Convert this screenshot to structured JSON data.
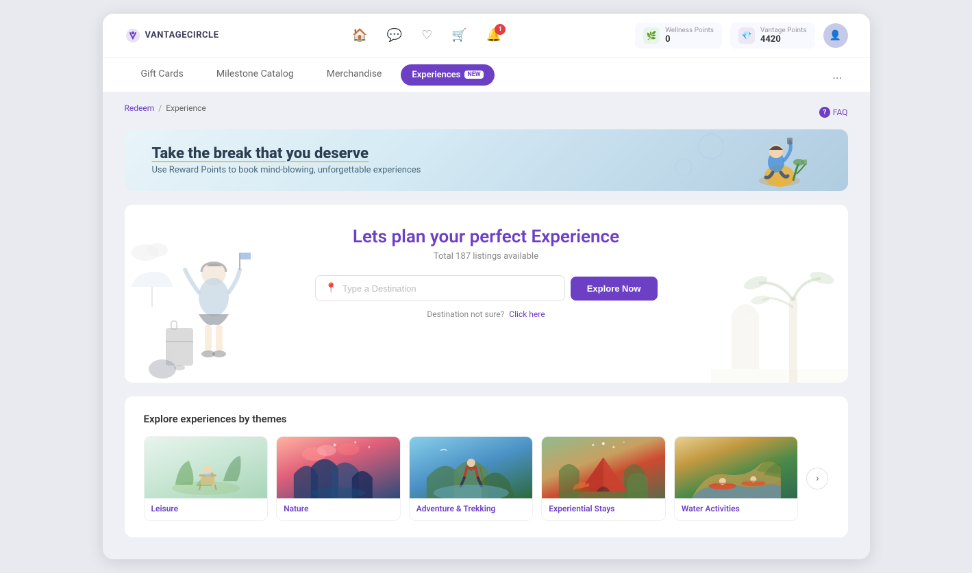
{
  "app": {
    "logo_text": "VANTAGECIRCLE"
  },
  "header": {
    "home_icon": "🏠",
    "chat_icon": "💬",
    "heart_icon": "♡",
    "cart_icon": "🛒",
    "notification_icon": "🔔",
    "notification_count": "1",
    "wellness_label": "Wellness Points",
    "wellness_value": "0",
    "vantage_label": "Vantage Points",
    "vantage_value": "4420",
    "avatar_icon": "👤"
  },
  "nav_tabs": {
    "gift_cards": "Gift Cards",
    "milestone_catalog": "Milestone Catalog",
    "merchandise": "Merchandise",
    "experiences": "Experiences",
    "experiences_new": "NEW",
    "more": "..."
  },
  "breadcrumb": {
    "redeem": "Redeem",
    "separator": "/",
    "experience": "Experience"
  },
  "faq": {
    "icon": "?",
    "label": "FAQ"
  },
  "banner": {
    "title_prefix": "Take the ",
    "title_bold": "break",
    "title_suffix": " that you deserve",
    "subtitle": "Use Reward Points to book mind-blowing, unforgettable experiences"
  },
  "search_section": {
    "title_prefix": "Lets plan your perfect ",
    "title_highlight": "Experience",
    "subtitle": "Total 187 listings available",
    "input_placeholder": "Type a Destination",
    "explore_button": "Explore Now",
    "hint_prefix": "Destination not sure?",
    "hint_link": "Click here"
  },
  "themes_section": {
    "title": "Explore experiences by themes",
    "cards": [
      {
        "label": "Leisure",
        "theme": "leisure"
      },
      {
        "label": "Nature",
        "theme": "nature"
      },
      {
        "label": "Adventure & Trekking",
        "theme": "adventure"
      },
      {
        "label": "Experiential Stays",
        "theme": "stays"
      },
      {
        "label": "Water Activities",
        "theme": "water"
      }
    ],
    "arrow": "›"
  }
}
